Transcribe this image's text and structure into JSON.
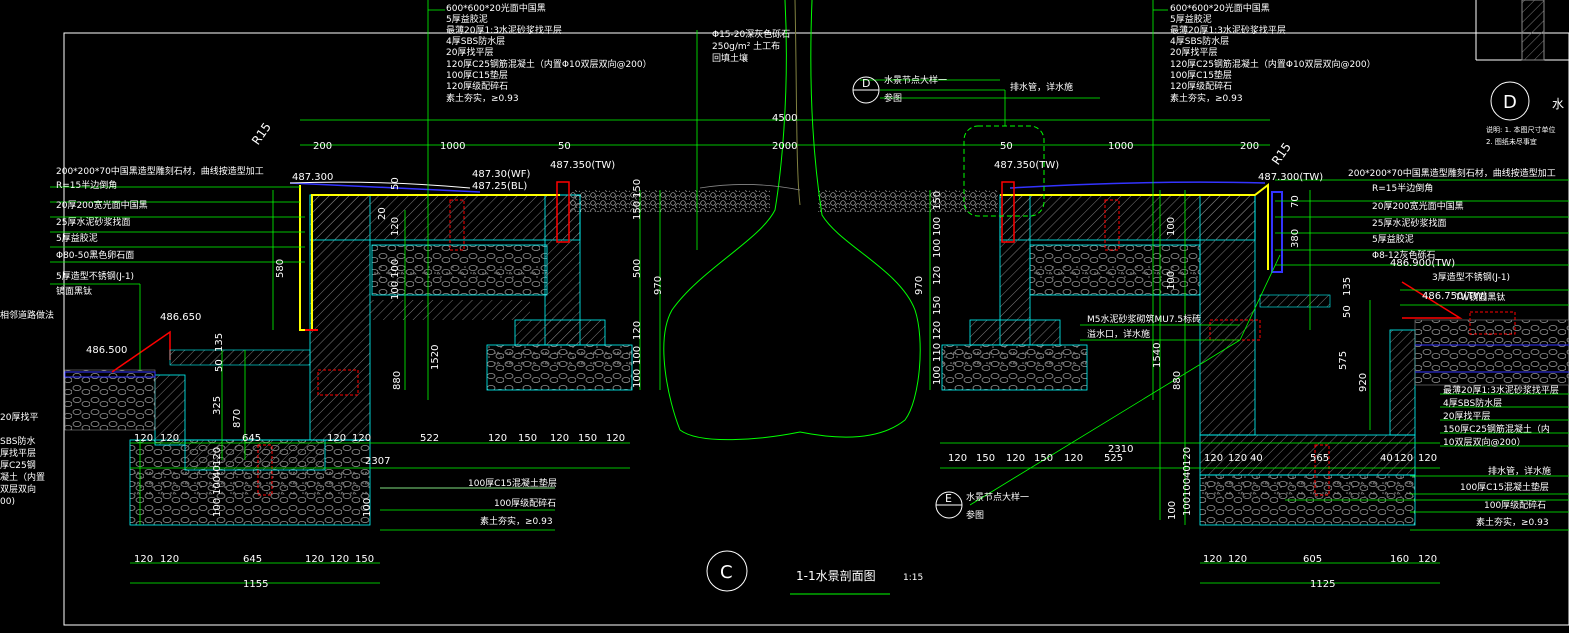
{
  "drawing": {
    "title": "1-1水景剖面图",
    "scale": "1:15",
    "section_mark": "C",
    "detail_mark_d": "D",
    "detail_mark_e": "E",
    "corner_detail_tag": "D",
    "corner_note_1": "水",
    "corner_note_2": "说明: 1. 本图尺寸单位",
    "corner_note_3": "2. 图纸未尽事宜"
  },
  "layer_callouts_left_top": [
    "600*600*20光面中国黑",
    "5厚益胶泥",
    "最薄20厚1:3水泥砂浆找平层",
    "4厚SBS防水层",
    "20厚找平层",
    "120厚C25钢筋混凝土（内置Φ10双层双向@200）",
    "100厚C15垫层",
    "120厚级配碎石",
    "素土夯实，≥0.93"
  ],
  "layer_callouts_right_top": [
    "600*600*20光面中国黑",
    "5厚益胶泥",
    "最薄20厚1:3水泥砂浆找平层",
    "4厚SBS防水层",
    "20厚找平层",
    "120厚C25钢筋混凝土（内置Φ10双层双向@200）",
    "100厚C15垫层",
    "120厚级配碎石",
    "素土夯实，≥0.93"
  ],
  "center_callouts": [
    "Φ15-20深灰色砾石",
    "250g/m² 土工布",
    "回填土壤"
  ],
  "left_callouts": [
    "200*200*70中国黑造型雕刻石材，曲线按造型加工",
    "R=15半边倒角",
    "20厚200宽光面中国黑",
    "25厚水泥砂浆找面",
    "5厚益胶泥",
    "Φ80-50黑色卵石面",
    "5厚造型不锈钢(J-1)",
    "镜面黑钛"
  ],
  "left_far_labels": [
    "相邻道路做法",
    "20厚找平",
    "SBS防水",
    "厚找平层",
    "厚C25钢",
    "凝土（内置",
    "双层双向",
    "00)"
  ],
  "right_callouts": [
    "200*200*70中国黑造型雕刻石材，曲线按造型加工",
    "R=15半边倒角",
    "20厚200宽光面中国黑",
    "25厚水泥砂浆找面",
    "5厚益胶泥",
    "Φ8-12灰色砾石",
    "3厚造型不锈钢(J-1)",
    "TW镜面黑钛"
  ],
  "right_lower_callouts": [
    "最薄20厚1:3水泥砂浆找平层",
    "4厚SBS防水层",
    "20厚找平层",
    "150厚C25钢筋混凝土（内",
    "10双层双向@200）"
  ],
  "mid_callouts": [
    "M5水泥砂浆砌筑MU7.5标砖",
    "溢水口，详水施",
    "排水管，详水施",
    "水景节点大样一",
    "参图"
  ],
  "bottom_left_callouts": [
    "100厚C15混凝土垫层",
    "100厚级配碎石",
    "素土夯实，≥0.93"
  ],
  "bottom_right_callouts": [
    "排水管，详水施",
    "100厚C15混凝土垫层",
    "100厚级配碎石",
    "素土夯实，≥0.93"
  ],
  "elevations": {
    "left_coping": "487.300",
    "wf": "487.30(WF)",
    "bl": "487.25(BL)",
    "tw_left": "487.350(TW)",
    "tw_right": "487.350(TW)",
    "right_coping": "487.300(TW)",
    "left_ground": "486.650",
    "left_outer": "486.500",
    "right_tw": "486.900(TW)",
    "right_tw2": "486.750(TW)"
  },
  "radius_left": "R15",
  "radius_right": "R15",
  "top_dims": {
    "total": "4500",
    "segments": [
      "200",
      "1000",
      "50",
      "2000",
      "50",
      "1000",
      "200"
    ]
  },
  "mid_dims_left": [
    "120",
    "150",
    "120",
    "150",
    "120"
  ],
  "mid_dim_left_522": "522",
  "mid_dims_right": [
    "120",
    "150",
    "120",
    "150",
    "120"
  ],
  "mid_dim_right_525": "525",
  "left_lower_dims": [
    "120",
    "120",
    "645",
    "120",
    "120"
  ],
  "left_total_2307": "2307",
  "right_total_2310": "2310",
  "right_lower_dims": [
    "120",
    "120",
    "40",
    "565",
    "40",
    "120",
    "120"
  ],
  "bottom_dims_left": [
    "120",
    "120",
    "645",
    "120",
    "120",
    "150"
  ],
  "bottom_total_left": "1155",
  "bottom_dims_right": [
    "120",
    "120",
    "605",
    "160",
    "120"
  ],
  "bottom_total_right": "1125",
  "vertical_dims_left": [
    "580",
    "50",
    "135",
    "325",
    "870",
    "120",
    "40",
    "100",
    "100",
    "100"
  ],
  "vertical_dims_center_left": [
    "50",
    "20",
    "120",
    "100",
    "100",
    "880",
    "1520",
    "500",
    "970",
    "150",
    "150",
    "120",
    "100",
    "100"
  ],
  "vertical_dims_center_right": [
    "970",
    "150",
    "100",
    "100",
    "120",
    "150",
    "120",
    "110",
    "100",
    "100",
    "100",
    "1540",
    "880"
  ],
  "vertical_dims_right": [
    "70",
    "380",
    "50",
    "135",
    "575",
    "920",
    "120",
    "40",
    "100",
    "100",
    "100"
  ],
  "colors": {
    "background": "#000000",
    "dimension": "#00ff00",
    "text": "#ffffff",
    "structure": "#00ffff",
    "hatch": "#8a8a8a",
    "water": "#3333ff",
    "steel": "#ff0000",
    "coping": "#ffff00",
    "frame": "#ffffff"
  }
}
